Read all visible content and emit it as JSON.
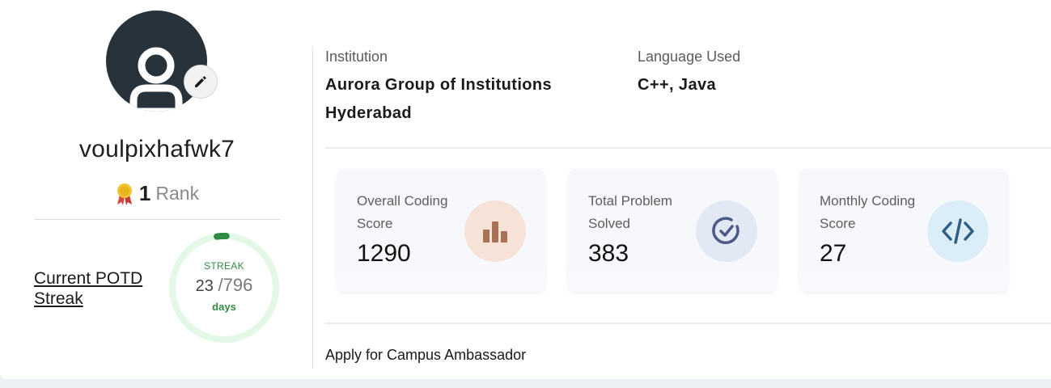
{
  "profile": {
    "username": "voulpixhafwk7",
    "rank_value": "1",
    "rank_label": "Rank"
  },
  "streak": {
    "link_text": "Current POTD Streak",
    "label": "STREAK",
    "current": "23",
    "total": "/796",
    "unit": "days",
    "progress_fraction": 0.029,
    "colors": {
      "track": "#e3f8e6",
      "fill": "#2f8a43"
    }
  },
  "info": {
    "institution_label": "Institution",
    "institution_value_line1": "Aurora Group of Institutions",
    "institution_value_line2": "Hyderabad",
    "language_label": "Language Used",
    "language_value": "C++, Java"
  },
  "stats": [
    {
      "label": "Overall Coding Score",
      "value": "1290",
      "icon": "bar-chart-icon",
      "icon_bg": "#f6e2d6",
      "icon_color": "#a87256"
    },
    {
      "label": "Total Problem Solved",
      "value": "383",
      "icon": "check-circle-icon",
      "icon_bg": "#e3e8f5",
      "icon_color": "#4b5a86"
    },
    {
      "label": "Monthly Coding Score",
      "value": "27",
      "icon": "code-icon",
      "icon_bg": "#dbeef8",
      "icon_color": "#2f5f86"
    }
  ],
  "footer": {
    "campus_link": "Apply for Campus Ambassador"
  }
}
